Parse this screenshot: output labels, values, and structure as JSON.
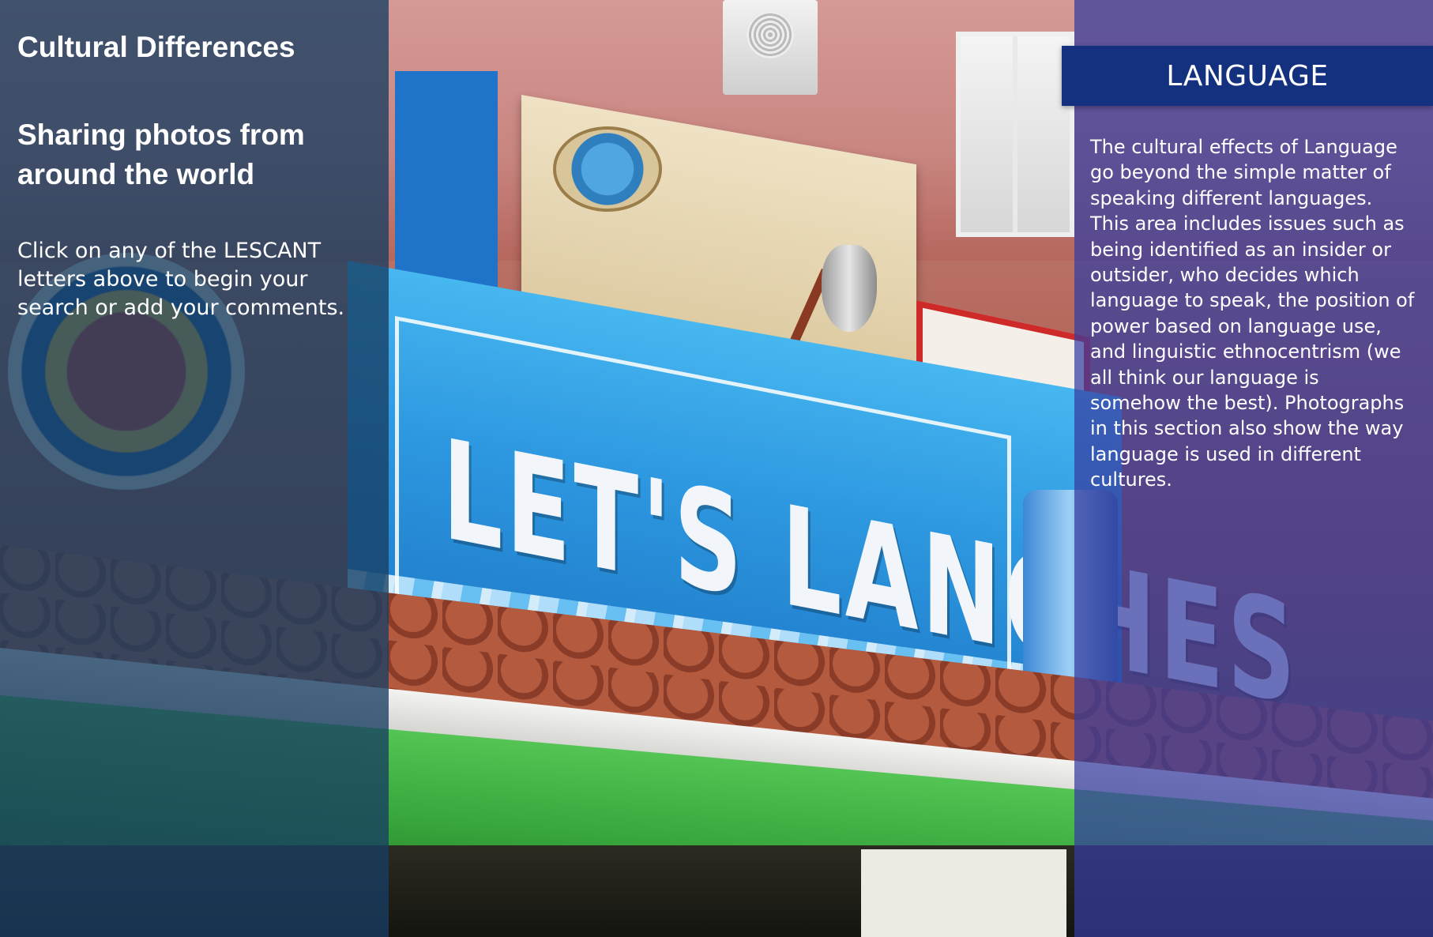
{
  "left_panel": {
    "title": "Cultural Differences",
    "subtitle": "Sharing photos from around the world",
    "instructions": "Click on any of the LESCANT letters above to begin your search or add your comments."
  },
  "right_panel": {
    "header": "LANGUAGE",
    "description": "The cultural effects of Language go beyond the simple matter of speaking different languages. This area includes issues such as being identified as an insider or outsider, who decides which language to speak, the position of power based on language use, and linguistic ethnocentrism (we all think our language is somehow the best). Photographs in this section also show the way language is used in different cultures."
  },
  "background_photo": {
    "subject": "street storefront signs",
    "sign_text": "LET'S LANCHES"
  },
  "colors": {
    "left_overlay": "#173e62",
    "right_overlay": "#343ca0",
    "header_bar": "#14317f",
    "text": "#ffffff"
  }
}
